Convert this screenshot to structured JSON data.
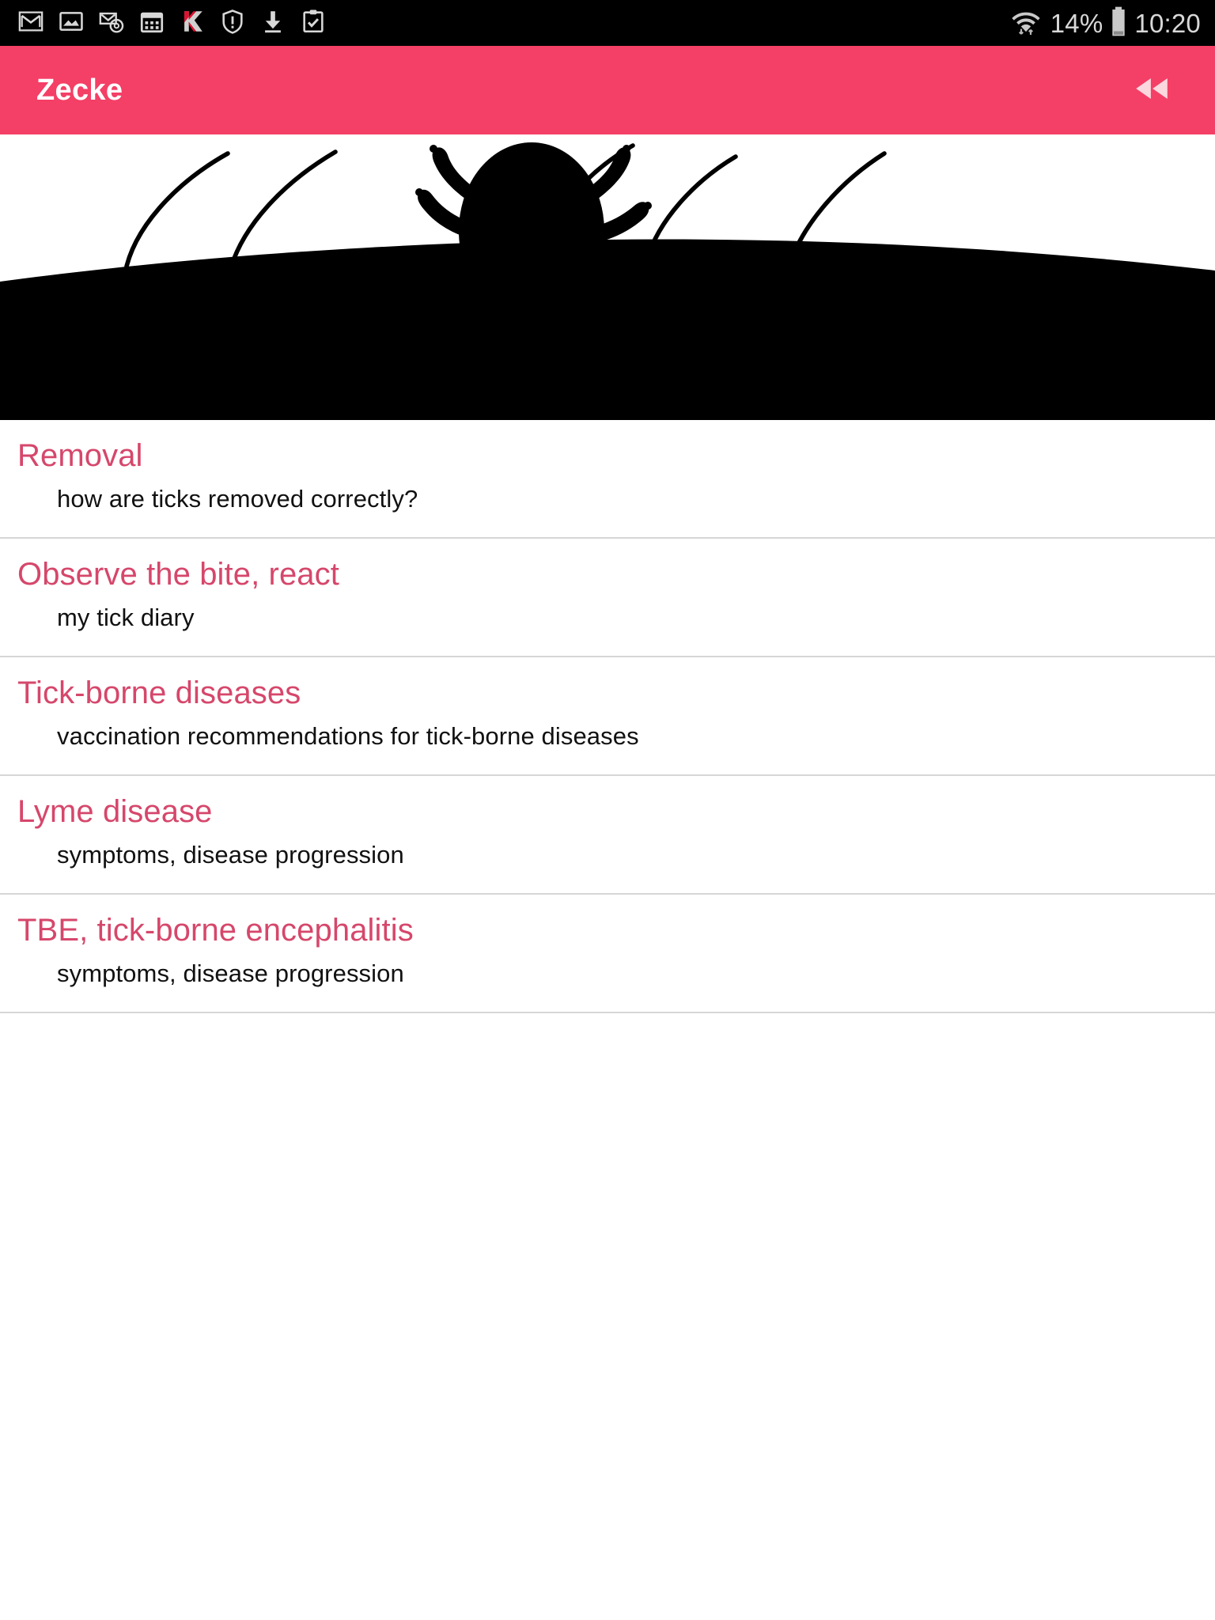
{
  "status_bar": {
    "background": "#000000",
    "left_icons": [
      {
        "name": "gmail-icon",
        "label": "Gmail"
      },
      {
        "name": "gallery-icon",
        "label": "Gallery"
      },
      {
        "name": "email-at-icon",
        "label": "Email"
      },
      {
        "name": "calendar-icon",
        "label": "Calendar"
      },
      {
        "name": "kaspersky-icon",
        "label": "Kaspersky"
      },
      {
        "name": "shield-alert-icon",
        "label": "Security alert"
      },
      {
        "name": "download-icon",
        "label": "Download"
      },
      {
        "name": "clipboard-check-icon",
        "label": "Tasks"
      }
    ],
    "wifi_icon": "wifi-icon",
    "battery_percent": "14%",
    "battery_icon": "battery-icon",
    "clock": "10:20"
  },
  "app_bar": {
    "title": "Zecke",
    "background": "#f43f66",
    "title_color": "#ffffff",
    "action_icon": "rewind-icon"
  },
  "hero": {
    "name": "tick-on-skin-illustration",
    "alt": "Black silhouette of a tick on skin with body hairs",
    "silhouette_color": "#000000",
    "background_color": "#ffffff"
  },
  "list": {
    "divider_color": "#d6d6d6",
    "title_color": "#d6476b",
    "subtitle_color": "#111111",
    "items": [
      {
        "title": "Removal",
        "subtitle": "how are ticks removed correctly?"
      },
      {
        "title": "Observe the bite, react",
        "subtitle": "my tick diary"
      },
      {
        "title": "Tick-borne diseases",
        "subtitle": "vaccination recommendations for tick-borne diseases"
      },
      {
        "title": "Lyme disease",
        "subtitle": "symptoms, disease progression"
      },
      {
        "title": "TBE, tick-borne encephalitis",
        "subtitle": "symptoms, disease progression"
      }
    ]
  }
}
